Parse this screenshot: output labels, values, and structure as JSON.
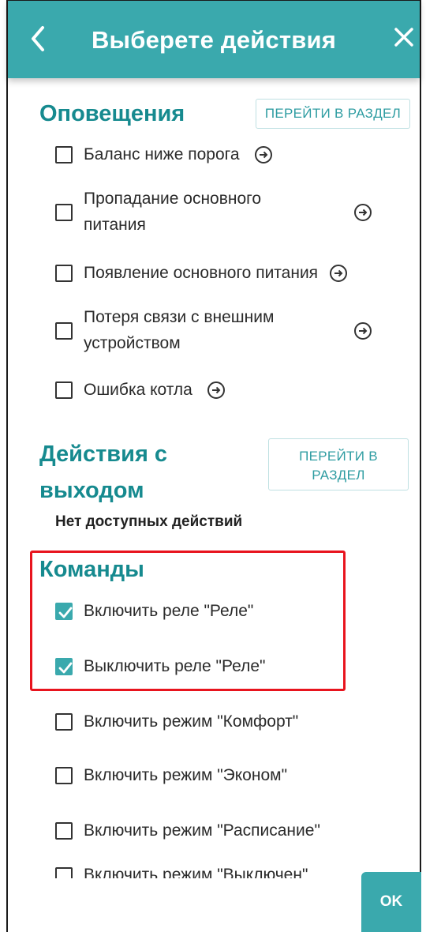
{
  "header": {
    "title": "Выберете действия",
    "back_icon": "chevron-left-icon",
    "close_icon": "close-icon"
  },
  "notifications": {
    "title": "Оповещения",
    "nav_button": "ПЕРЕЙТИ В РАЗДЕЛ",
    "items": [
      {
        "label": "Баланс ниже порога",
        "checked": false
      },
      {
        "label_line1": "Пропадание основного",
        "label_line2": "питания",
        "checked": false
      },
      {
        "label": "Появление основного питания",
        "checked": false
      },
      {
        "label_line1": "Потеря связи с внешним",
        "label_line2": "устройством",
        "checked": false
      },
      {
        "label": "Ошибка котла",
        "checked": false
      }
    ]
  },
  "output_actions": {
    "title_line1": "Действия с",
    "title_line2": "выходом",
    "nav_button_line1": "ПЕРЕЙТИ В",
    "nav_button_line2": "РАЗДЕЛ",
    "empty_text": "Нет доступных действий"
  },
  "commands": {
    "title": "Команды",
    "items": [
      {
        "label": "Включить реле \"Реле\"",
        "checked": true
      },
      {
        "label": "Выключить реле \"Реле\"",
        "checked": true
      },
      {
        "label": "Включить режим \"Комфорт\"",
        "checked": false
      },
      {
        "label": "Включить режим \"Эконом\"",
        "checked": false
      },
      {
        "label": "Включить режим \"Расписание\"",
        "checked": false
      },
      {
        "label": "Включить режим \"Выключен\"",
        "checked": false
      }
    ]
  },
  "footer": {
    "ok_label": "OK"
  },
  "colors": {
    "accent": "#3aa9ad",
    "section_title": "#168a8f",
    "highlight": "#e8141e"
  }
}
